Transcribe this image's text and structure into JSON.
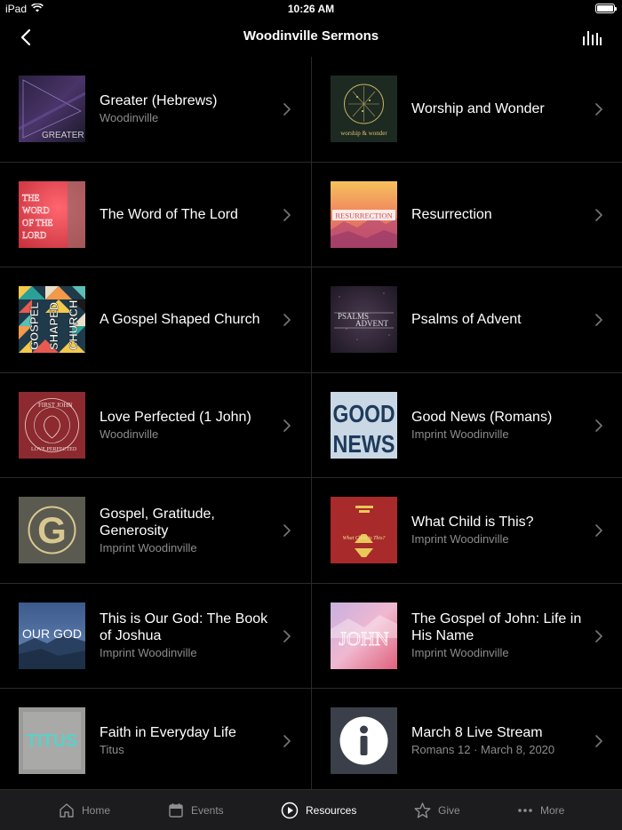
{
  "status": {
    "device": "iPad",
    "time": "10:26 AM",
    "battery_level": 1.0
  },
  "nav": {
    "title": "Woodinville Sermons",
    "back_icon": "chevron-left-icon",
    "stats_icon": "bar-chart-icon"
  },
  "items": [
    {
      "title": "Greater (Hebrews)",
      "subtitle": "Woodinville",
      "art_text": "GREATER"
    },
    {
      "title": "Worship and Wonder",
      "subtitle": "",
      "art_text": "worship & wonder"
    },
    {
      "title": "The Word of The Lord",
      "subtitle": "",
      "art_text": "THE WORD OF THE LORD"
    },
    {
      "title": "Resurrection",
      "subtitle": "",
      "art_text": "RESURRECTION"
    },
    {
      "title": "A Gospel Shaped Church",
      "subtitle": "",
      "art_text": "GOSPEL SHAPED CHURCH"
    },
    {
      "title": "Psalms of Advent",
      "subtitle": "",
      "art_text": "PSALMS ADVENT"
    },
    {
      "title": "Love Perfected (1 John)",
      "subtitle": "Woodinville",
      "art_text": "FIRST JOHN LOVE PERFECTED"
    },
    {
      "title": "Good News (Romans)",
      "subtitle": "Imprint Woodinville",
      "art_text": "GOOD NEWS"
    },
    {
      "title": "Gospel, Gratitude, Generosity",
      "subtitle": "Imprint Woodinville",
      "art_text": "G"
    },
    {
      "title": "What Child is This?",
      "subtitle": "Imprint Woodinville",
      "art_text": "What Child is This?"
    },
    {
      "title": "This is Our God: The Book of Joshua",
      "subtitle": "Imprint Woodinville",
      "art_text": "OUR GOD"
    },
    {
      "title": "The Gospel of John: Life in His Name",
      "subtitle": "Imprint Woodinville",
      "art_text": "JOHN"
    },
    {
      "title": "Faith in Everyday Life",
      "subtitle": "Titus",
      "art_text": "TITUS"
    },
    {
      "title": "March 8 Live Stream",
      "subtitle": "Romans 12 · March 8, 2020",
      "art_text": "i"
    }
  ],
  "tabs": [
    {
      "label": "Home",
      "icon": "home-icon",
      "active": false
    },
    {
      "label": "Events",
      "icon": "calendar-icon",
      "active": false
    },
    {
      "label": "Resources",
      "icon": "play-circle-icon",
      "active": true
    },
    {
      "label": "Give",
      "icon": "star-icon",
      "active": false
    },
    {
      "label": "More",
      "icon": "more-dots-icon",
      "active": false
    }
  ],
  "colors": {
    "background": "#000000",
    "divider": "#2a2a2a",
    "subtitle": "#8c8c8c",
    "tab_bar": "#1c1c1e",
    "tab_inactive": "#8e8e93",
    "tab_active": "#ffffff"
  }
}
